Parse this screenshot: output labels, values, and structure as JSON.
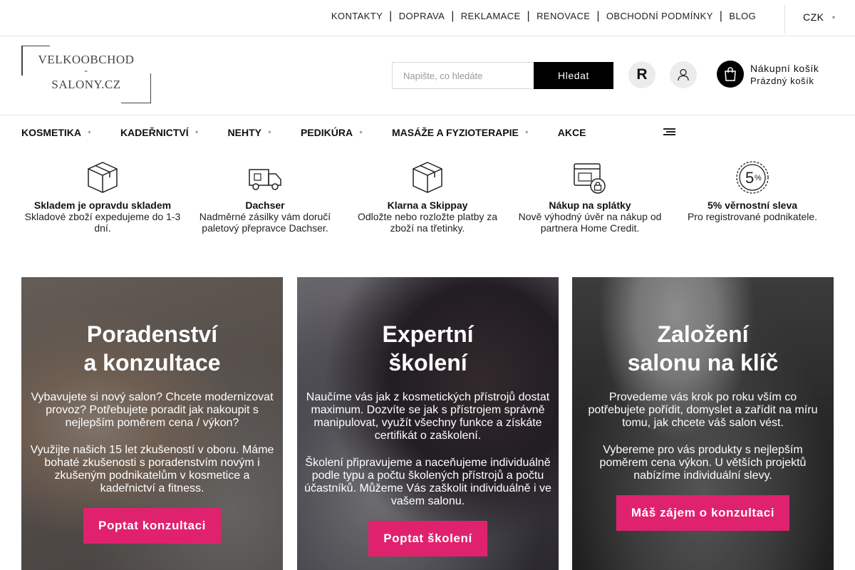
{
  "top_links": [
    "KONTAKTY",
    "DOPRAVA",
    "REKLAMACE",
    "RENOVACE",
    "OBCHODNÍ PODMÍNKY",
    "BLOG"
  ],
  "currency": "CZK",
  "logo": {
    "line1": "VELKOOBCHOD",
    "line2": "-",
    "line3": "SALONY.CZ"
  },
  "search": {
    "placeholder": "Napište, co hledáte",
    "button": "Hledat"
  },
  "r_button": "R",
  "cart": {
    "title": "Nákupní košík",
    "status": "Prázdný košík"
  },
  "nav": [
    "KOSMETIKA",
    "KADEŘNICTVÍ",
    "NEHTY",
    "PEDIKÚRA",
    "MASÁŽE A FYZIOTERAPIE",
    "AKCE"
  ],
  "features": [
    {
      "icon": "box-icon",
      "title": "Skladem je opravdu skladem",
      "desc": "Skladové zboží expedujeme do 1-3 dní."
    },
    {
      "icon": "truck-icon",
      "title": "Dachser",
      "desc": "Nadměrné zásilky vám doručí paletový přepravce Dachser."
    },
    {
      "icon": "box-icon",
      "title": "Klarna a Skippay",
      "desc": "Odložte nebo rozložte platby za zboží na třetinky."
    },
    {
      "icon": "secure-payment-icon",
      "title": "Nákup na splátky",
      "desc": "Nově výhodný úvěr na nákup od partnera Home Credit."
    },
    {
      "icon": "percent-badge-icon",
      "title": "5% věrnostní sleva",
      "desc": "Pro registrované podnikatele."
    }
  ],
  "cards": [
    {
      "title_l1": "Poradenství",
      "title_l2": "a konzultace",
      "p1": "Vybavujete si nový salon? Chcete modernizovat provoz? Potřebujete poradit jak nakoupit s nejlepším poměrem cena / výkon?",
      "p2": "Využijte našich 15 let zkušeností v oboru. Máme bohaté zkušenosti s poradenstvím novým i zkušeným podnikatelům v kosmetice a kadeřnictví a fitness.",
      "button": "Poptat konzultaci"
    },
    {
      "title_l1": "Expertní",
      "title_l2": "školení",
      "p1": "Naučíme vás jak z kosmetických přístrojů dostat maximum. Dozvíte se jak s přístrojem správně manipulovat, využít všechny funkce a získáte certifikát o zaškolení.",
      "p2": "Školení připravujeme a naceňujeme individuálně podle typu a počtu školených přístrojů a počtu účastníků. Můžeme Vás zaškolit individuálně i ve vašem salonu.",
      "button": "Poptat školení"
    },
    {
      "title_l1": "Založení",
      "title_l2": "salonu na klíč",
      "p1": "Provedeme vás krok po roku vším co potřebujete pořídit, domyslet a zařídit na míru tomu, jak chcete váš salon vést.",
      "p2": "Vybereme pro vás produkty s nejlepším poměrem cena výkon. U větších projektů nabízíme individuální slevy.",
      "button": "Máš zájem o konzultaci"
    }
  ],
  "colors": {
    "accent": "#e0226e",
    "black": "#000000"
  }
}
